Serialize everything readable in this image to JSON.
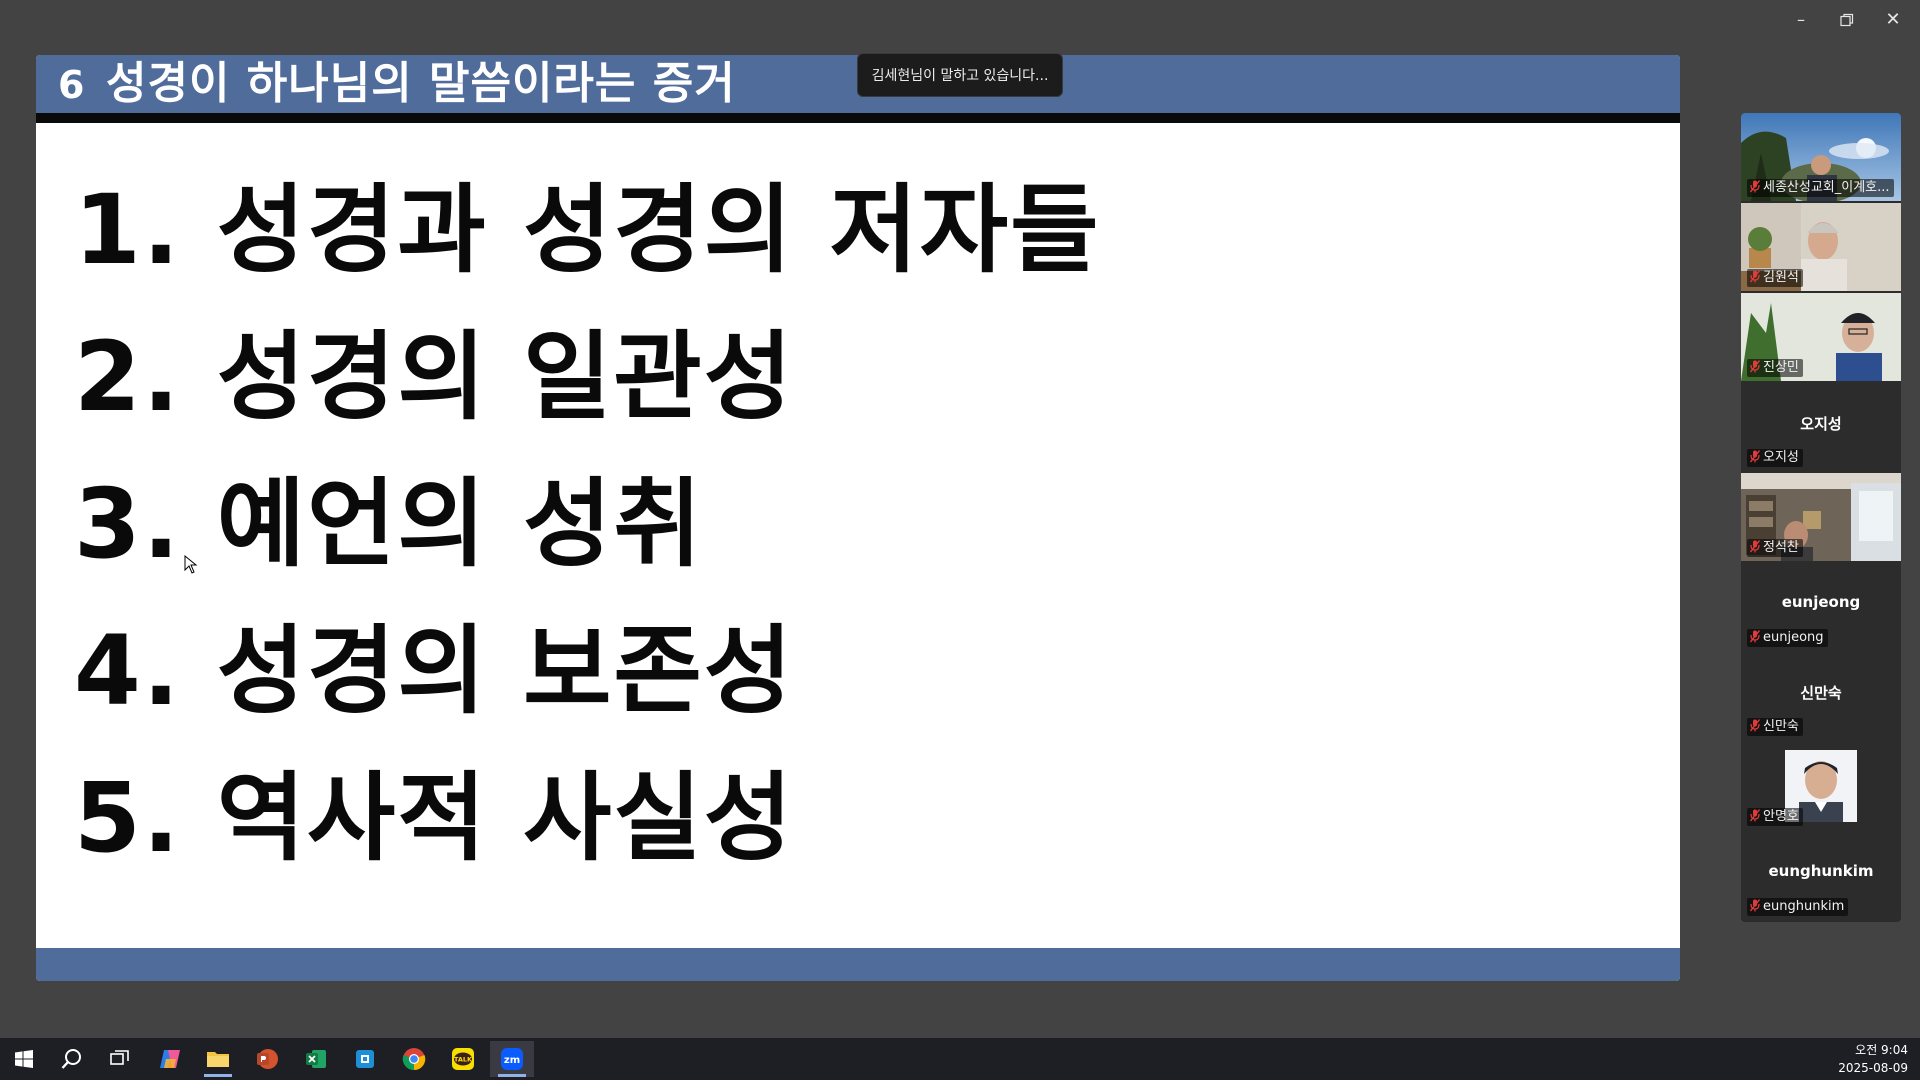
{
  "window": {
    "minimize_icon": "minimize-icon",
    "restore_icon": "restore-icon",
    "close_icon": "close-icon"
  },
  "slide": {
    "number": "6",
    "title": "성경이 하나님의 말씀이라는 증거",
    "items": [
      "1. 성경과 성경의 저자들",
      "2. 성경의 일관성",
      "3. 예언의 성취",
      "4. 성경의 보존성",
      "5. 역사적 사실성"
    ],
    "colors": {
      "header": "#4f6c9b",
      "footer": "#4f6c9b",
      "text": "#0a0a0a"
    }
  },
  "speaker_toast": "김세현님이 말하고 있습니다...",
  "participants": [
    {
      "name": "세종산성교회_이계호...",
      "video": true,
      "muted": true
    },
    {
      "name": "김원석",
      "video": true,
      "muted": true
    },
    {
      "name": "진상민",
      "video": true,
      "muted": true
    },
    {
      "name": "오지성",
      "display_name": "오지성",
      "video": false,
      "muted": true
    },
    {
      "name": "정석찬",
      "video": true,
      "muted": true
    },
    {
      "name": "eunjeong",
      "display_name": "eunjeong",
      "video": false,
      "muted": true
    },
    {
      "name": "신만숙",
      "display_name": "신만숙",
      "video": false,
      "muted": true
    },
    {
      "name": "안명호",
      "video": true,
      "muted": true
    },
    {
      "name": "eunghunkim",
      "display_name": "eunghunkim",
      "video": false,
      "muted": true
    }
  ],
  "taskbar": {
    "apps": [
      "windows-start-icon",
      "search-icon",
      "task-view-icon",
      "copilot-icon",
      "file-explorer-icon",
      "powerpoint-icon",
      "excel-icon",
      "store-icon",
      "chrome-icon",
      "kakaotalk-icon",
      "zoom-icon"
    ],
    "active_app": "zoom-icon",
    "kakaotalk_label": "TALK",
    "zoom_label": "zm",
    "time": "오전 9:04",
    "date": "2025-08-09"
  }
}
